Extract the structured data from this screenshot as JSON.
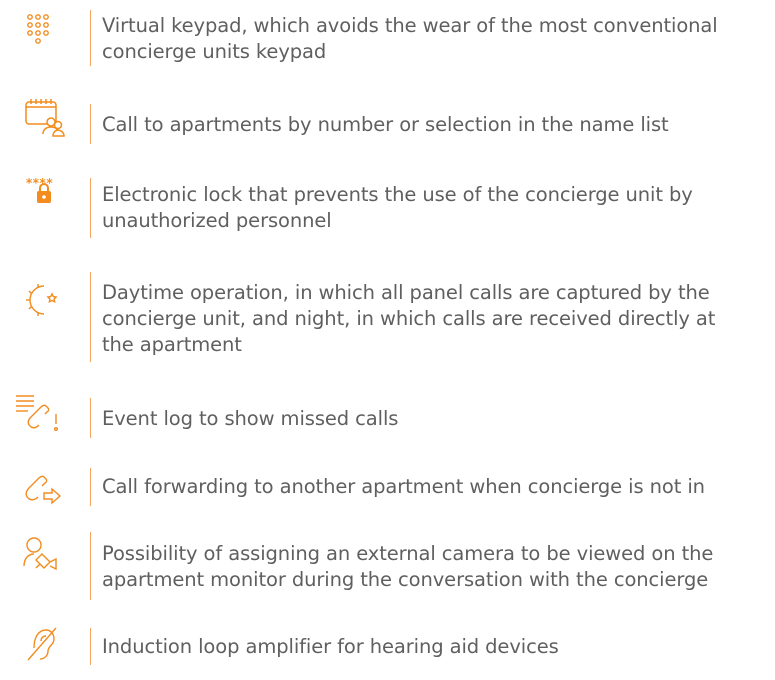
{
  "accent_color": "#f28c1e",
  "features": [
    {
      "icon": "keypad-icon",
      "text_lines": [
        "Virtual keypad, which avoids the wear of the most conventional",
        "concierge units keypad"
      ]
    },
    {
      "icon": "calendar-contacts-icon",
      "text_lines": [
        "Call to apartments by number or selection in the name list"
      ]
    },
    {
      "icon": "password-lock-icon",
      "icon_text": "****",
      "text_lines": [
        "Electronic lock that prevents the use of the concierge unit by",
        "unauthorized personnel"
      ]
    },
    {
      "icon": "day-night-icon",
      "text_lines": [
        "Daytime operation, in which all panel calls are captured by the",
        "concierge unit, and night, in which calls are received directly at",
        "the apartment"
      ]
    },
    {
      "icon": "missed-call-log-icon",
      "text_lines": [
        "Event log to show missed calls"
      ]
    },
    {
      "icon": "call-forward-icon",
      "text_lines": [
        "Call forwarding to another apartment when concierge is not in"
      ]
    },
    {
      "icon": "person-camera-icon",
      "text_lines": [
        "Possibility of assigning an external camera to be viewed on the",
        "apartment monitor during the conversation with the concierge"
      ]
    },
    {
      "icon": "hearing-loop-icon",
      "text_lines": [
        "Induction loop amplifier for hearing aid devices"
      ]
    }
  ]
}
